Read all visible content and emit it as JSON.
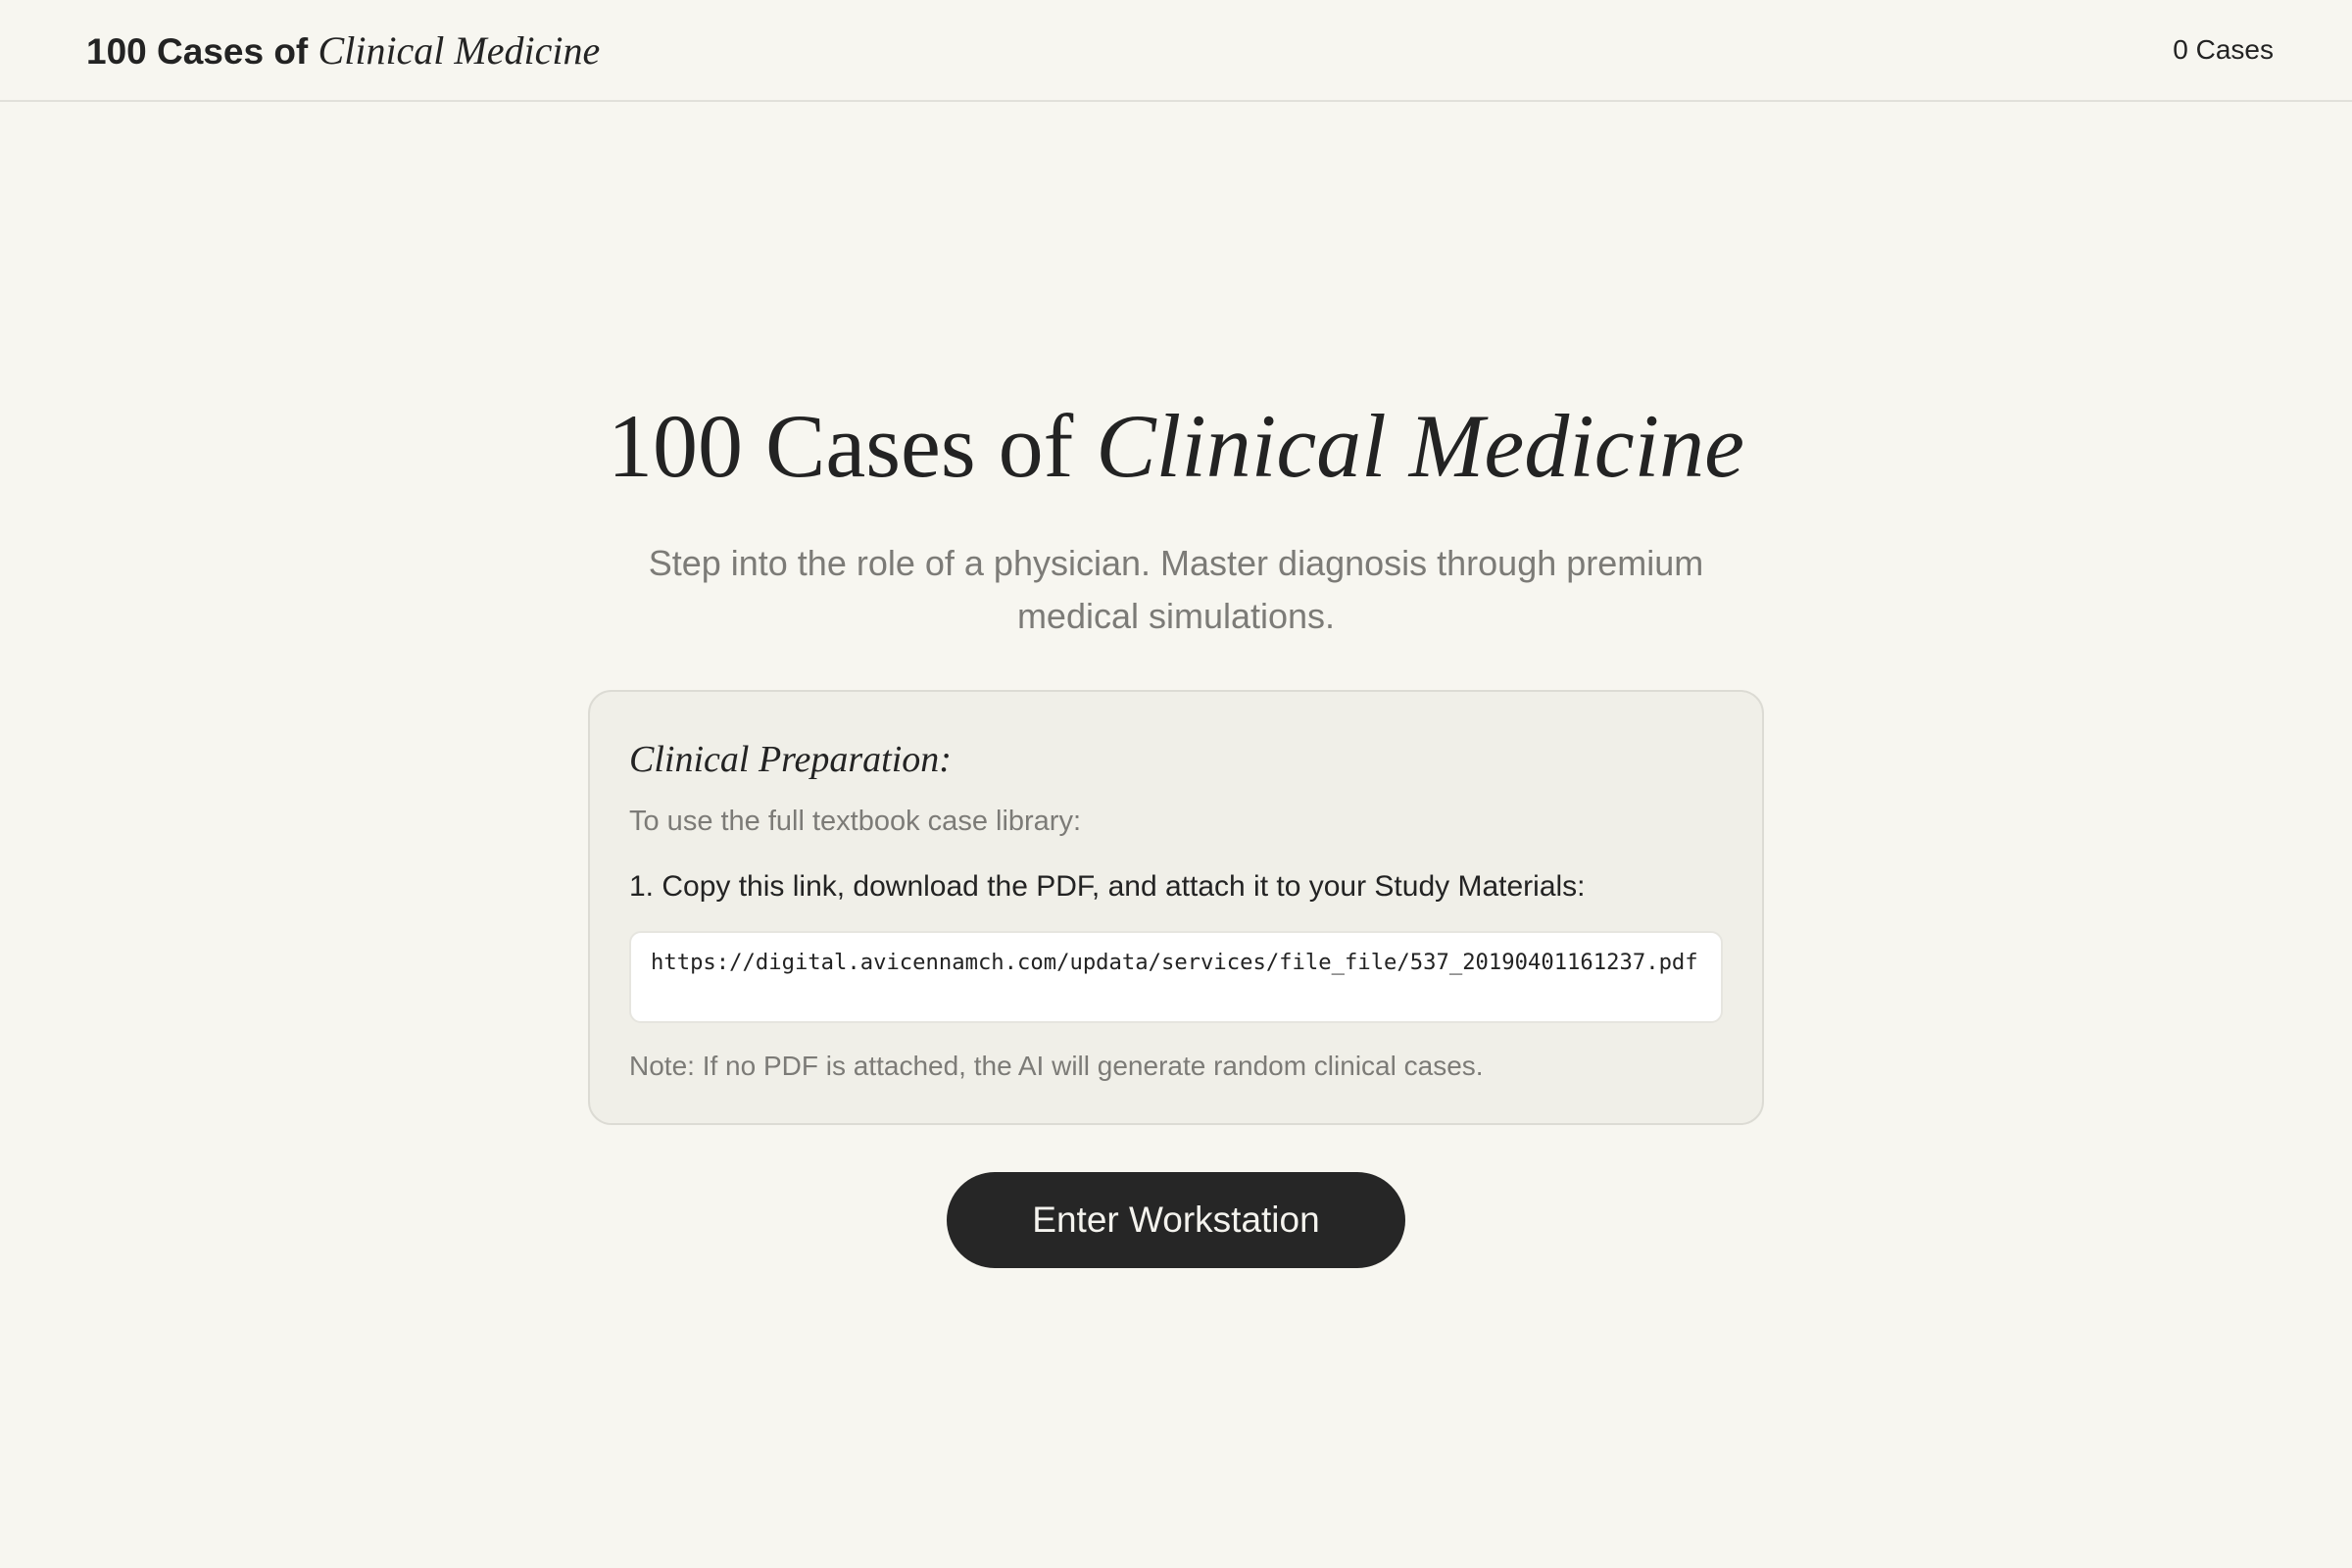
{
  "header": {
    "brand_plain": "100 Cases of",
    "brand_fancy": "Clinical Medicine",
    "case_count": "0 Cases"
  },
  "hero": {
    "title_plain": "100 Cases of",
    "title_fancy": "Clinical Medicine",
    "subtitle": "Step into the role of a physician. Master diagnosis through premium medical simulations."
  },
  "prep": {
    "title": "Clinical Preparation:",
    "intro": "To use the full textbook case library:",
    "step1": "1. Copy this link, download the PDF, and attach it to your Study Materials:",
    "link": "https://digital.avicennamch.com/updata/services/file_file/537_20190401161237.pdf",
    "note": "Note: If no PDF is attached, the AI will generate random clinical cases."
  },
  "cta": {
    "label": "Enter Workstation"
  },
  "colors": {
    "background": "#f7f6f0",
    "panel": "#f0efe8",
    "text": "#232323",
    "muted": "#7c7b77",
    "button": "#262626"
  }
}
